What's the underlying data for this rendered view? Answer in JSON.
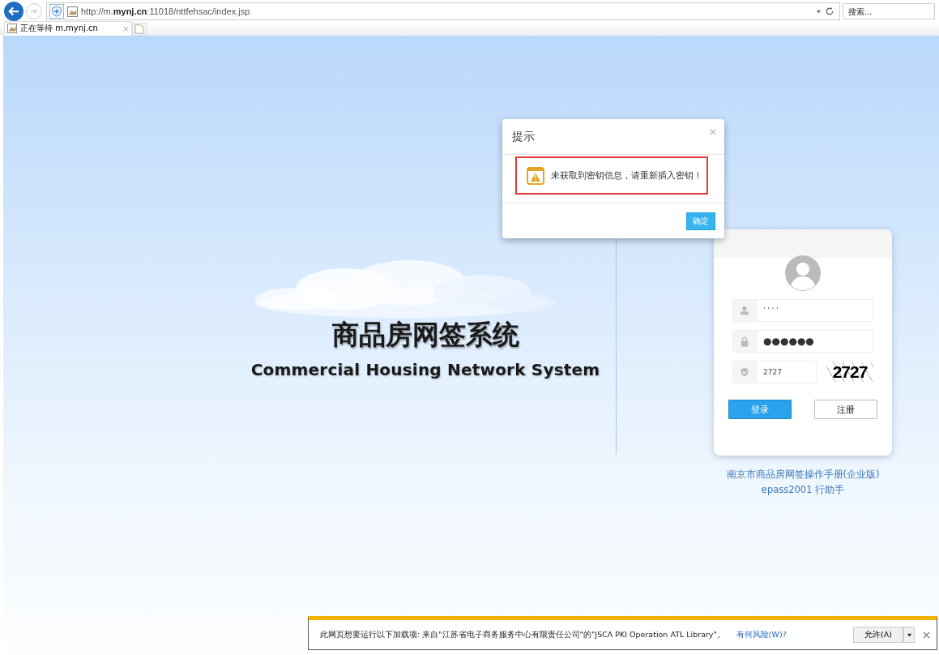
{
  "browser": {
    "address": {
      "prefix": "http://m.",
      "host": "mynj.cn",
      "suffix": ":11018/nttfehsac/index.jsp"
    },
    "search": {
      "placeholder": "搜索..."
    },
    "tabs": [
      {
        "label": "正在等待 m.mynj.cn",
        "selected": true
      }
    ]
  },
  "hero": {
    "title": "商品房网签系统",
    "subtitle": "Commercial Housing Network System"
  },
  "login": {
    "username": {
      "value": "' '  ' '"
    },
    "password": {
      "value": "●●●●●●"
    },
    "captcha": {
      "value": "2727",
      "image_text": "2727"
    },
    "buttons": [
      {
        "label": "登录",
        "kind": "primary"
      },
      {
        "label": "注册",
        "kind": "secondary"
      }
    ],
    "links": [
      "南京市商品房网签操作手册(企业版)",
      "epass2001 行助手"
    ]
  },
  "dialog": {
    "title": "提示",
    "message": "未获取到密钥信息，请重新插入密钥！",
    "button": "确定"
  },
  "infobar": {
    "message": "此网页想要运行以下加载项: 来自\"江苏省电子商务服务中心有限责任公司\"的\"JSCA PKI Operation ATL Library\"。",
    "link": "有何风险(W)?",
    "button": "允许(A)"
  }
}
